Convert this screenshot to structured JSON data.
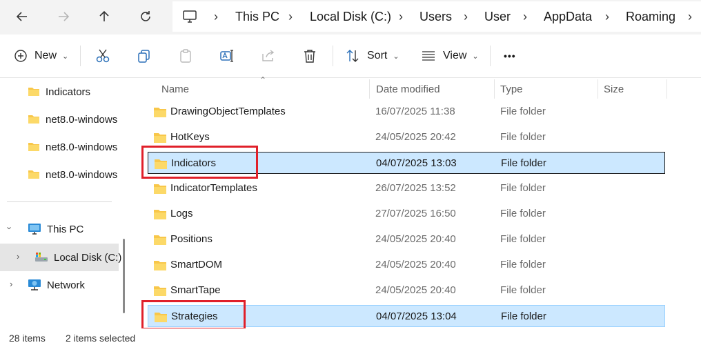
{
  "address": {
    "crumbs": [
      "This PC",
      "Local Disk (C:)",
      "Users",
      "User",
      "AppData",
      "Roaming"
    ]
  },
  "commands": {
    "new_label": "New",
    "sort_label": "Sort",
    "view_label": "View",
    "more_label": "•••"
  },
  "nav": {
    "folders": [
      "Indicators",
      "net8.0-windows",
      "net8.0-windows",
      "net8.0-windows"
    ],
    "this_pc": "This PC",
    "local_disk": "Local Disk (C:)",
    "network": "Network"
  },
  "columns": {
    "name": "Name",
    "date": "Date modified",
    "type": "Type",
    "size": "Size"
  },
  "rows": [
    {
      "name": "DrawingObjectTemplates",
      "date": "16/07/2025 11:38",
      "type": "File folder"
    },
    {
      "name": "HotKeys",
      "date": "24/05/2025 20:42",
      "type": "File folder"
    },
    {
      "name": "Indicators",
      "date": "04/07/2025 13:03",
      "type": "File folder",
      "selected": true
    },
    {
      "name": "IndicatorTemplates",
      "date": "26/07/2025 13:52",
      "type": "File folder"
    },
    {
      "name": "Logs",
      "date": "27/07/2025 16:50",
      "type": "File folder"
    },
    {
      "name": "Positions",
      "date": "24/05/2025 20:40",
      "type": "File folder"
    },
    {
      "name": "SmartDOM",
      "date": "24/05/2025 20:40",
      "type": "File folder"
    },
    {
      "name": "SmartTape",
      "date": "24/05/2025 20:40",
      "type": "File folder"
    },
    {
      "name": "Strategies",
      "date": "04/07/2025 13:04",
      "type": "File folder",
      "selected": true
    }
  ],
  "status": {
    "items": "28 items",
    "selected": "2 items selected"
  },
  "colors": {
    "selection": "#cce8ff",
    "highlight": "#e0202a",
    "folder": "#f8c74a"
  },
  "icons": [
    "back-arrow-icon",
    "forward-arrow-icon",
    "up-arrow-icon",
    "refresh-icon",
    "monitor-icon",
    "new-icon",
    "cut-icon",
    "copy-icon",
    "paste-icon",
    "rename-icon",
    "share-icon",
    "delete-icon",
    "sort-icon",
    "view-icon",
    "folder-icon",
    "network-icon"
  ]
}
